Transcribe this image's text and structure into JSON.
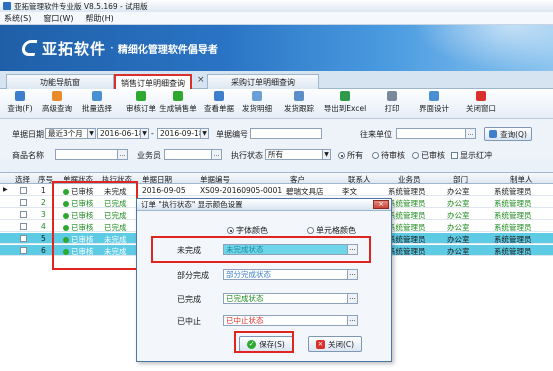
{
  "window": {
    "title": "亚拓管理软件专业版 V8.5.169 - 试用版"
  },
  "menu": {
    "items": [
      "系统(S)",
      "窗口(W)",
      "帮助(H)"
    ]
  },
  "brand": {
    "name": "亚拓软件",
    "dot": "·",
    "slogan": "精细化管理软件倡导者"
  },
  "tabs": [
    {
      "label": "功能导航窗"
    },
    {
      "label": "销售订单明细查询"
    },
    {
      "label": "采购订单明细查询"
    }
  ],
  "tab_close": "×",
  "toolbar": {
    "buttons": [
      {
        "label": "查询(F)",
        "color": "#3d7fcc"
      },
      {
        "label": "高级查询",
        "color": "#e98a2c"
      },
      {
        "label": "批量选择",
        "color": "#4a8fd4"
      },
      {
        "label": "审核订单",
        "color": "#2fa82f"
      },
      {
        "label": "生成销售单",
        "color": "#2fa82f"
      },
      {
        "label": "查看单据",
        "color": "#3d7fcc"
      },
      {
        "label": "发货明细",
        "color": "#6a9fd8"
      },
      {
        "label": "发货跟踪",
        "color": "#5c8fc8"
      },
      {
        "label": "导出到Excel",
        "color": "#2e9a4a"
      },
      {
        "label": "打印",
        "color": "#7a8a9c"
      },
      {
        "label": "界面设计",
        "color": "#4a8fd4"
      },
      {
        "label": "关闭窗口",
        "color": "#d9302c"
      }
    ]
  },
  "filters": {
    "date_label": "单据日期",
    "date_range": "最近3个月",
    "date_from": "2016-06-18",
    "date_to": "2016-09-18",
    "doc_no_label": "单据编号",
    "partner_label": "往来单位",
    "product_label": "商品名称",
    "salesman_label": "业务员",
    "exec_status_label": "执行状态",
    "exec_status_value": "所有",
    "radio_all": "所有",
    "radio_pending": "待审核",
    "radio_approved": "已审核",
    "show_red": "显示红冲",
    "query_button": "查询(Q)"
  },
  "grid": {
    "columns": [
      "选择",
      "序号",
      "单据状态",
      "执行状态",
      "单据日期",
      "单据编号",
      "客户",
      "联系人",
      "业务员",
      "部门",
      "制单人"
    ],
    "rows": [
      {
        "no": "1",
        "status": "已审核",
        "exec": "未完成",
        "date": "2016-09-05",
        "doc": "XS09-20160905-0001",
        "customer": "碧瑞文具店",
        "contact": "李文",
        "sales": "系统管理员",
        "dept": "办公室",
        "maker": "系统管理员"
      },
      {
        "no": "2",
        "status": "已审核",
        "exec": "已完成",
        "date": "",
        "doc": "",
        "customer": "",
        "contact": "",
        "sales": "系统管理员",
        "dept": "办公室",
        "maker": "系统管理员"
      },
      {
        "no": "3",
        "status": "已审核",
        "exec": "已完成",
        "date": "",
        "doc": "",
        "customer": "",
        "contact": "",
        "sales": "系统管理员",
        "dept": "办公室",
        "maker": "系统管理员"
      },
      {
        "no": "4",
        "status": "已审核",
        "exec": "已完成",
        "date": "",
        "doc": "",
        "customer": "",
        "contact": "",
        "sales": "系统管理员",
        "dept": "办公室",
        "maker": "系统管理员"
      },
      {
        "no": "5",
        "status": "已审核",
        "exec": "未完成",
        "date": "",
        "doc": "",
        "customer": "",
        "contact": "",
        "sales": "系统管理员",
        "dept": "办公室",
        "maker": "系统管理员"
      },
      {
        "no": "6",
        "status": "已审核",
        "exec": "未完成",
        "date": "",
        "doc": "",
        "customer": "",
        "contact": "",
        "sales": "系统管理员",
        "dept": "办公室",
        "maker": "系统管理员"
      }
    ]
  },
  "dialog": {
    "title": "订单 \"执行状态\" 显示颜色设置",
    "close": "×",
    "radio_font": "字体颜色",
    "radio_cell": "单元格颜色",
    "rows": [
      {
        "label": "未完成",
        "value": "未完成状态",
        "color": "#1c8a9c"
      },
      {
        "label": "部分完成",
        "value": "部分完成状态",
        "color": "#3b7fc4"
      },
      {
        "label": "已完成",
        "value": "已完成状态",
        "color": "#1c8a1c"
      },
      {
        "label": "已中止",
        "value": "已中止状态",
        "color": "#d9302c"
      }
    ],
    "ellipsis": "...",
    "save_button": "保存(S)",
    "close_button": "关闭(C)"
  }
}
